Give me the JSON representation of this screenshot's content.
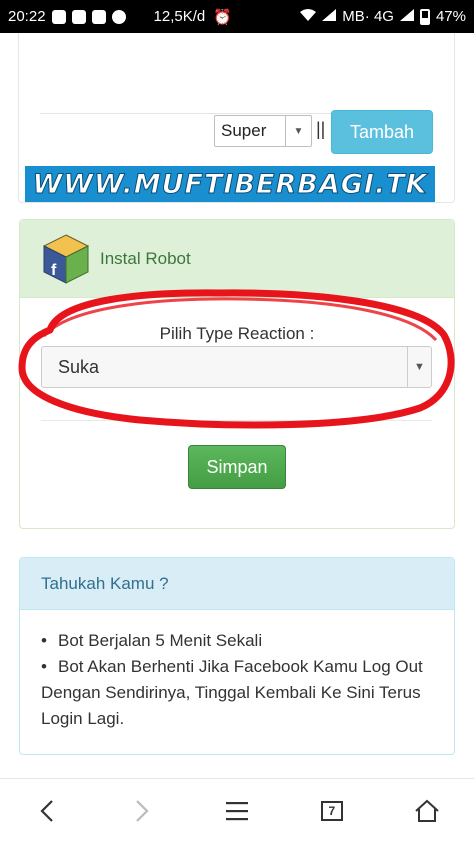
{
  "status_bar": {
    "time": "20:22",
    "speed": "12,5K/d",
    "network": "MB· 4G",
    "battery": "47%"
  },
  "top_panel": {
    "select_value": "Super",
    "separator": "||",
    "add_button": "Tambah"
  },
  "watermark": "WWW.MUFTIBERBAGI.TK",
  "robot_panel": {
    "title": "Instal Robot",
    "reaction_label": "Pilih Type Reaction :",
    "reaction_value": "Suka",
    "save_button": "Simpan"
  },
  "info_panel": {
    "title": "Tahukah Kamu ?",
    "items": [
      "Bot Berjalan 5 Menit Sekali",
      "Bot Akan Berhenti Jika Facebook Kamu Log Out Dengan Sendirinya, Tinggal Kembali Ke Sini Terus Login Lagi."
    ]
  },
  "nav_bar": {
    "tab_count": "7"
  },
  "colors": {
    "info_button": "#5bc0de",
    "success_button": "#5cb85c",
    "success_header": "#dff0d8",
    "info_header": "#d9edf7",
    "annotation_ellipse": "#e8141b"
  }
}
